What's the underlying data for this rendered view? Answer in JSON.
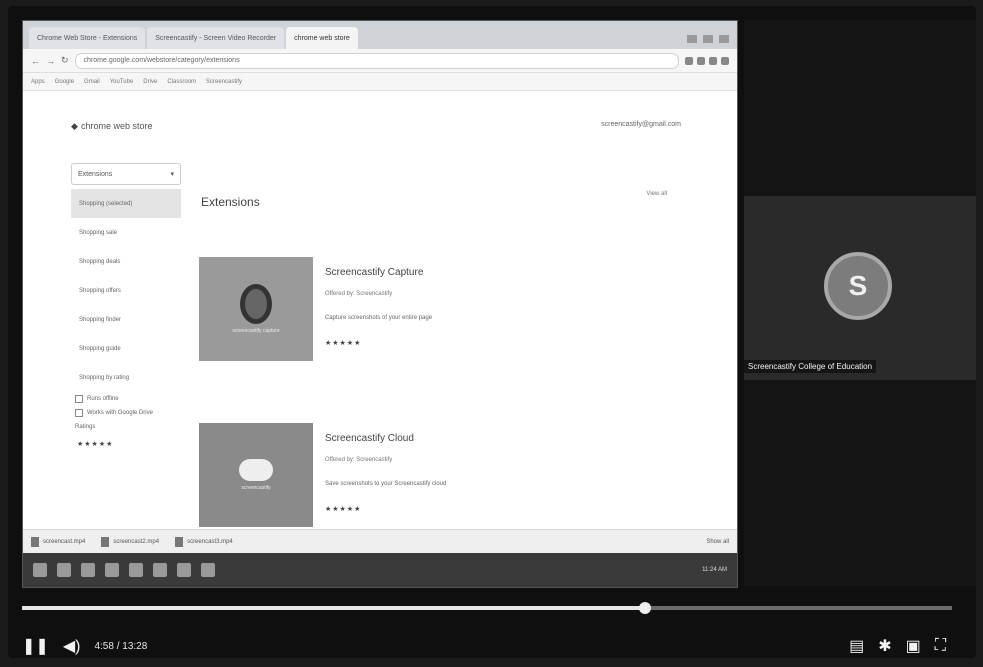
{
  "browser": {
    "tabs": [
      {
        "label": "Chrome Web Store - Extensions",
        "active": false
      },
      {
        "label": "Screencastify - Screen Video Recorder",
        "active": false
      },
      {
        "label": "chrome web store",
        "active": true
      }
    ],
    "url": "chrome.google.com/webstore/category/extensions",
    "bookmarks": [
      "Apps",
      "Google",
      "Gmail",
      "YouTube",
      "Drive",
      "Classroom",
      "Screencastify"
    ]
  },
  "store": {
    "title": "chrome web store",
    "user": "screencastify@gmail.com",
    "category_selected": "Extensions",
    "categories": [
      "Shopping (selected)",
      "Shopping sale",
      "Shopping deals",
      "Shopping offers",
      "Shopping finder",
      "Shopping guide",
      "Shopping by rating"
    ],
    "filters": [
      "Runs offline",
      "Works with Google Drive"
    ],
    "ratings_label": "Ratings",
    "ratings_stars": "★★★★★",
    "section_title": "Extensions",
    "section_more": "View all",
    "cards": [
      {
        "name": "Screencastify Capture",
        "meta": "Offered by: Screencastify",
        "desc": "Capture screenshots of your entire page",
        "stars": "★★★★★",
        "logo_caption": "screencastify capture"
      },
      {
        "name": "Screencastify Cloud",
        "meta": "Offered by: Screencastify",
        "desc": "Save screenshots to your Screencastify cloud",
        "stars": "★★★★★",
        "logo_caption": "screencastify"
      }
    ]
  },
  "downloads": [
    "screencast.mp4",
    "screencast2.mp4",
    "screencast3.mp4",
    "Show all"
  ],
  "taskbar": {
    "clock": "11:24 AM"
  },
  "participant": {
    "initial": "S",
    "name": "Screencastify College of Education"
  },
  "player": {
    "time": "4:58 / 13:28",
    "progress": 0.67,
    "colors": {
      "played": "#e6e6e6",
      "track": "#6b6b6b"
    }
  },
  "icons": [
    "pause-icon",
    "volume-icon",
    "subtitles-icon",
    "settings-icon",
    "miniplayer-icon",
    "fullscreen-icon"
  ]
}
